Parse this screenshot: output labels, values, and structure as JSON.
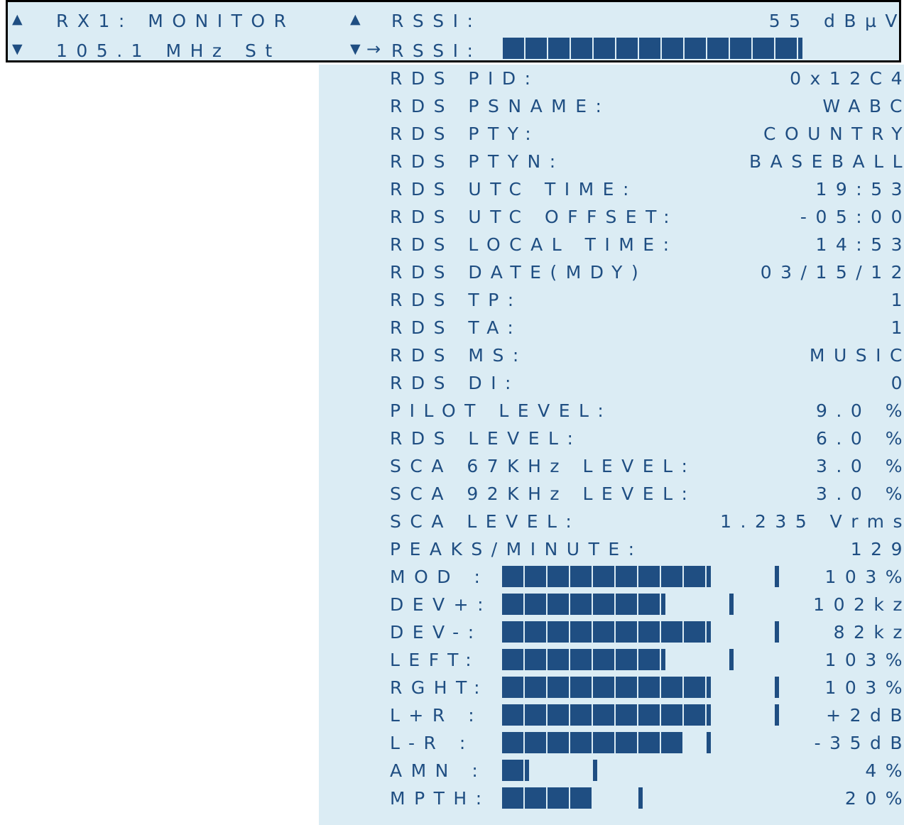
{
  "header": {
    "rx_label": "RX1: MONITOR",
    "frequency": "105.1 MHz St",
    "rssi_label": "RSSI:",
    "rssi_value": "55 dBµV",
    "rssi_bar_label": "RSSI:",
    "rssi_bar_level_blocks": 13.3,
    "icons": {
      "up_left": "triangle-up-icon",
      "down_left": "triangle-down-icon",
      "up_right": "triangle-up-icon",
      "down_right": "triangle-down-icon",
      "selector": "right-arrow-icon"
    }
  },
  "rows": [
    {
      "label": "RDS PID:",
      "value": "0x12C4"
    },
    {
      "label": "RDS PSNAME:",
      "value": "WABC"
    },
    {
      "label": "RDS PTY:",
      "value": "COUNTRY"
    },
    {
      "label": "RDS PTYN:",
      "value": "BASEBALL"
    },
    {
      "label": "RDS UTC TIME:",
      "value": "19:53"
    },
    {
      "label": "RDS UTC OFFSET:",
      "value": "-05:00"
    },
    {
      "label": "RDS LOCAL TIME:",
      "value": "14:53"
    },
    {
      "label": "RDS DATE(MDY)",
      "value": "03/15/12"
    },
    {
      "label": "RDS TP:",
      "value": "1"
    },
    {
      "label": "RDS TA:",
      "value": "1"
    },
    {
      "label": "RDS MS:",
      "value": "MUSIC"
    },
    {
      "label": "RDS DI:",
      "value": "0"
    },
    {
      "label": "PILOT LEVEL:",
      "value": "9.0 %"
    },
    {
      "label": "RDS LEVEL:",
      "value": "6.0 %"
    },
    {
      "label": "SCA 67KHz LEVEL:",
      "value": "3.0 %"
    },
    {
      "label": "SCA 92KHz LEVEL:",
      "value": "3.0 %"
    },
    {
      "label": "SCA LEVEL:",
      "value": "1.235 Vrms"
    },
    {
      "label": "PEAKS/MINUTE:",
      "value": "129"
    }
  ],
  "meters": [
    {
      "label": "MOD :",
      "value": "103%",
      "level_blocks": 9.3,
      "marker_blocks": 12.3
    },
    {
      "label": "DEV+:",
      "value": "102kz",
      "level_blocks": 7.3,
      "marker_blocks": 10.3
    },
    {
      "label": "DEV-:",
      "value": "82kz",
      "level_blocks": 9.3,
      "marker_blocks": 12.3
    },
    {
      "label": "LEFT:",
      "value": "103%",
      "level_blocks": 7.3,
      "marker_blocks": 10.3
    },
    {
      "label": "RGHT:",
      "value": "103%",
      "level_blocks": 9.3,
      "marker_blocks": 12.3
    },
    {
      "label": "L+R :",
      "value": "+2dB",
      "level_blocks": 9.3,
      "marker_blocks": 12.3
    },
    {
      "label": "L-R :",
      "value": "-35dB",
      "level_blocks": 8,
      "marker_blocks": 9.3
    },
    {
      "label": "AMN :",
      "value": "4%",
      "level_blocks": 1.3,
      "marker_blocks": 4.3
    },
    {
      "label": "MPTH:",
      "value": "20%",
      "level_blocks": 4,
      "marker_blocks": 6.3
    }
  ]
}
